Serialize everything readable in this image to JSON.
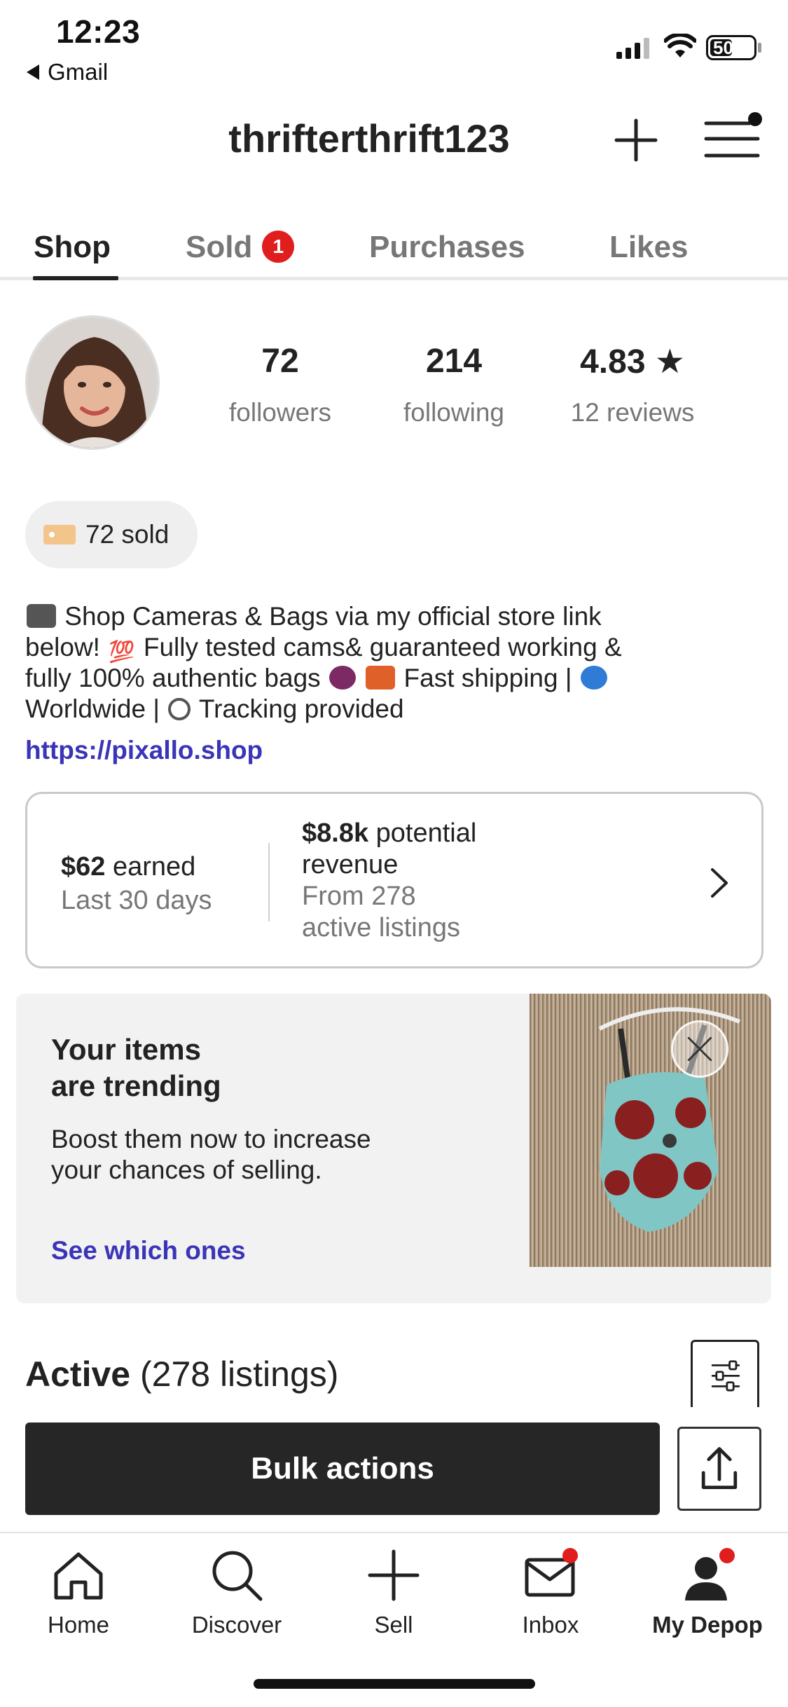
{
  "status_bar": {
    "time": "12:23",
    "back_app": "Gmail",
    "battery": "50"
  },
  "header": {
    "username": "thrifterthrift123",
    "plus_icon": "plus-icon",
    "menu_icon": "hamburger-menu-icon"
  },
  "tabs": [
    {
      "label": "Shop",
      "active": true
    },
    {
      "label": "Sold",
      "badge": "1"
    },
    {
      "label": "Purchases"
    },
    {
      "label": "Likes"
    }
  ],
  "profile": {
    "stats": [
      {
        "value": "72",
        "label": "followers"
      },
      {
        "value": "214",
        "label": "following"
      },
      {
        "value": "4.83 ★",
        "label": "12 reviews"
      }
    ],
    "sold_pill": "72 sold",
    "bio_lines": [
      "Shop Cameras & Bags via my official store link",
      "below!",
      "Fully tested cams& guaranteed working &",
      "fully 100% authentic bags",
      "Fast shipping |",
      "Worldwide |",
      "Tracking provided"
    ],
    "link": "https://pixallo.shop"
  },
  "earnings": {
    "earned_amount": "$62",
    "earned_word": "earned",
    "earned_period": "Last 30 days",
    "revenue_amount": "$8.8k",
    "revenue_word": "potential",
    "revenue_word2": "revenue",
    "revenue_from": "From 278",
    "revenue_listings": "active listings"
  },
  "trending": {
    "title_line1": "Your items",
    "title_line2": "are trending",
    "body": "Boost them now to increase your chances of selling.",
    "link": "See which ones"
  },
  "active": {
    "title": "Active",
    "count": "(278 listings)",
    "bulk_label": "Bulk actions"
  },
  "nav": [
    {
      "label": "Home",
      "icon": "home-icon"
    },
    {
      "label": "Discover",
      "icon": "search-icon"
    },
    {
      "label": "Sell",
      "icon": "plus-icon"
    },
    {
      "label": "Inbox",
      "icon": "mail-icon",
      "dot": true
    },
    {
      "label": "My Depop",
      "icon": "profile-icon",
      "dot": true,
      "active": true
    }
  ],
  "colors": {
    "accent_link": "#3a34b8",
    "badge_red": "#e01e1e",
    "dark_button": "#262626"
  }
}
